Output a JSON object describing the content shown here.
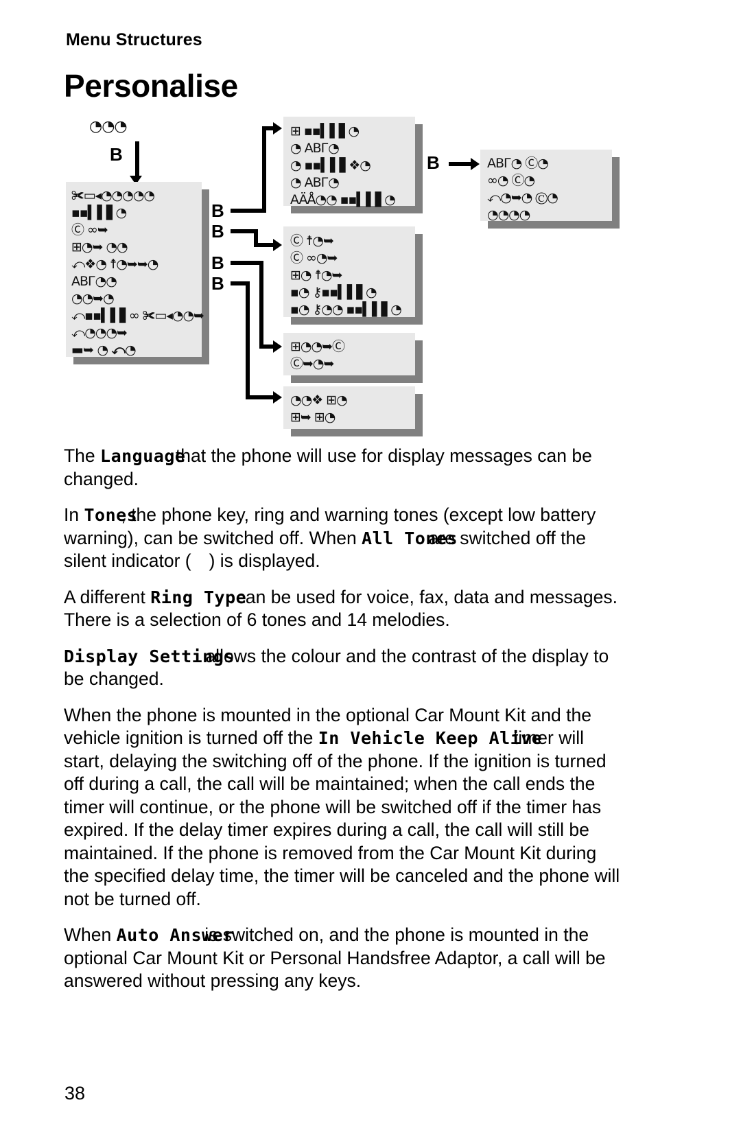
{
  "header": {
    "running_head": "Menu Structures",
    "title": "Personalise"
  },
  "diagram": {
    "branch_labels": {
      "root": "B",
      "b1": "B",
      "b2": "B",
      "b3": "B",
      "b4": "B",
      "b5": "B"
    },
    "root_node": "◔◔◔",
    "main_menu": {
      "name": "personalise-menu-box",
      "rows": [
        "✀▭◂◔◔◔◔◔",
        "▪▪▍▌▋◔",
        "Ⓒ  ∞➥",
        "⊞◔➥ ◔◔",
        "⤺❖◔  ☨◔➥➥◔",
        "ABГ◔◔",
        "◔◔➥◔",
        "⤺▪▪▍▌▋∞  ✀▭◂◔◔➥",
        "⤺◔◔◔➥",
        "▬➥  ◔  ⤺◔"
      ]
    },
    "sub_boxes": [
      {
        "name": "display-settings-box",
        "rows": [
          "⊞ ▪▪▍▌▋◔",
          "◔  ABГ◔",
          "◔  ▪▪▍▌▋❖◔",
          "◔  ABГ◔",
          "AÄÅ◔◔  ▪▪▍▌▋◔"
        ]
      },
      {
        "name": "tones-box",
        "rows": [
          "Ⓒ ☨◔➥",
          "Ⓒ ∞◔➥",
          "⊞◔ ☨◔➥",
          "▪◔ ⚷▪▪▍▌▋◔",
          "▪◔ ⚷◔◔ ▪▪▍▌▋◔"
        ]
      },
      {
        "name": "in-vehicle-box",
        "rows": [
          "⊞◔◔➥Ⓒ",
          "Ⓒ➥◔➥"
        ]
      },
      {
        "name": "auto-answer-box",
        "rows": [
          "◔◔❖ ⊞◔",
          "⊞➥ ⊞◔"
        ]
      },
      {
        "name": "language-box",
        "rows": [
          "ABГ◔  Ⓒ◔",
          "∞◔  Ⓒ◔",
          "⤺◔➥◔  Ⓒ◔",
          "◔◔◔◔"
        ]
      }
    ]
  },
  "paragraphs": {
    "p1": {
      "lead": "The ",
      "term": "Language",
      "rest": "that the phone will use for display messages can be changed."
    },
    "p2": {
      "lead": "In ",
      "term": "Tones",
      "mid": ", the phone key, ring and warning tones (except low battery warning), can be switched off. When ",
      "term2": "All Tones",
      "rest_a": "are switched off the silent indicator (",
      "rest_b": ") is displayed."
    },
    "p3": {
      "lead": "A different ",
      "term": "Ring Type",
      "rest": "can be used for voice, fax, data and messages. There is a selection of 6 tones and 14 melodies."
    },
    "p4": {
      "term": "Display Settings",
      "rest": "allows the colour and the contrast of the display to be changed."
    },
    "p5": {
      "lead": "When the phone is mounted in the optional Car Mount Kit and the vehicle ignition is turned off the ",
      "term": "In Vehicle Keep Alive",
      "rest": "timer will start, delaying the switching off of the phone. If the ignition is turned off during a call, the call will be maintained; when the call ends the timer will continue, or the phone will be switched off if the timer has expired. If the delay timer expires during a call, the call will still be maintained. If the phone is removed from the Car Mount Kit during the specified delay time, the timer will be canceled and the phone will not be turned off."
    },
    "p6": {
      "lead": "When ",
      "term": "Auto Answer",
      "rest": "is switched on, and the phone is mounted in the optional Car Mount Kit or Personal Handsfree Adaptor, a call will be answered without pressing any keys."
    }
  },
  "footer": {
    "page_number": "38"
  },
  "colors": {
    "box_fill": "#e8e8e8",
    "box_shadow": "#808080",
    "text": "#000000",
    "page": "#ffffff"
  }
}
